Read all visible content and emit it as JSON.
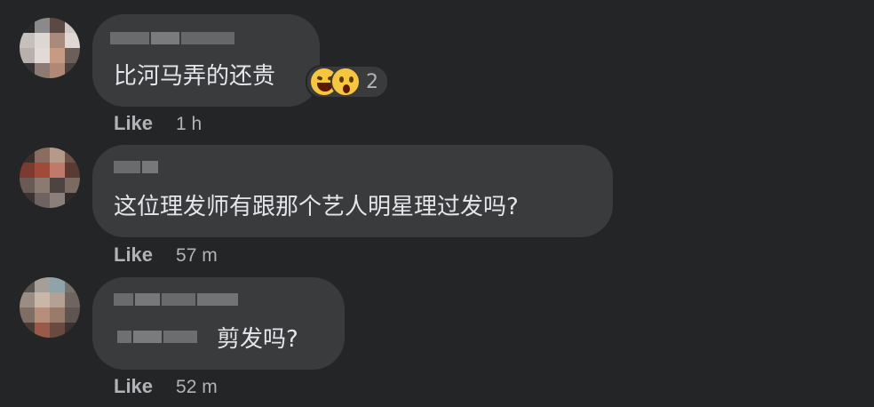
{
  "comments": [
    {
      "text": "比河马弄的还贵",
      "reaction_count": "2",
      "reactions": [
        "laughing-emoji-icon",
        "wow-emoji-icon"
      ],
      "like_label": "Like",
      "time": "1 h"
    },
    {
      "text": "这位理发师有跟那个艺人明星理过发吗?",
      "like_label": "Like",
      "time": "57 m"
    },
    {
      "text": "剪发吗?",
      "like_label": "Like",
      "time": "52 m"
    }
  ],
  "colors": {
    "background": "#242526",
    "bubble": "#3a3b3c",
    "text": "#e4e6eb",
    "secondary_text": "#b0b3b8",
    "reaction_yellow": "#f7c63c"
  }
}
